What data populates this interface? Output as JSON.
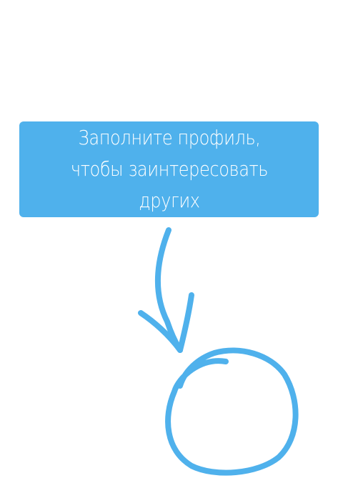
{
  "hint": {
    "text": "Заполните профиль, чтобы заинтересовать других"
  },
  "colors": {
    "accent": "#4fb1ec",
    "text_on_accent": "#ffffff",
    "background": "#ffffff"
  }
}
